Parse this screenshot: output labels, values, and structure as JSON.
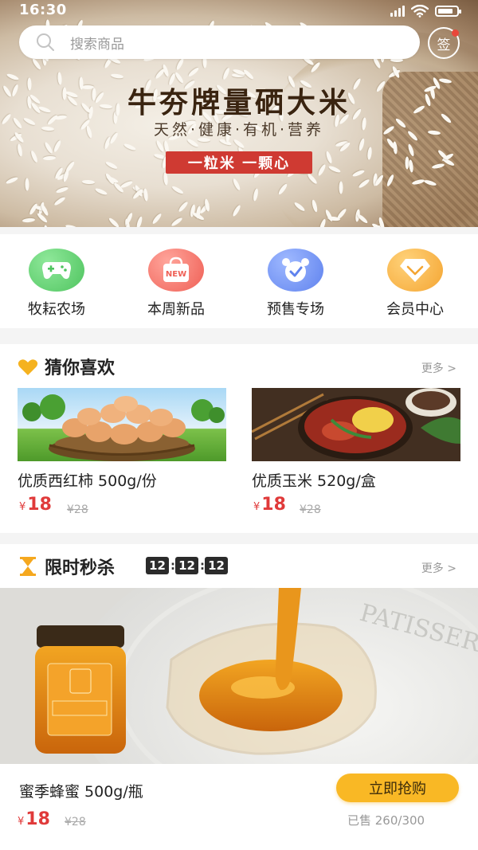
{
  "status_bar": {
    "time": "16:30"
  },
  "search": {
    "placeholder": "搜索商品"
  },
  "signin": {
    "label": "签"
  },
  "banner": {
    "title": "牛夯牌量硒大米",
    "subtitle": "天然·健康·有机·营养",
    "tagline": "一粒米 一颗心"
  },
  "categories": [
    {
      "label": "牧耘农场",
      "icon": "gamepad-icon",
      "color": "#5fcf6e"
    },
    {
      "label": "本周新品",
      "icon": "new-bag-icon",
      "color": "#f4736a",
      "badge": "NEW"
    },
    {
      "label": "预售专场",
      "icon": "alarm-clock-icon",
      "color": "#6b8ff5"
    },
    {
      "label": "会员中心",
      "icon": "diamond-icon",
      "color": "#f5b340"
    }
  ],
  "guess": {
    "title": "猜你喜欢",
    "more": "更多 >",
    "products": [
      {
        "name": "优质西红柿 500g/份",
        "currency": "¥",
        "price": "18",
        "old_price": "¥28",
        "image": "eggs-in-nest-photo"
      },
      {
        "name": "优质玉米 520g/盒",
        "currency": "¥",
        "price": "18",
        "old_price": "¥28",
        "image": "noodle-dish-photo"
      }
    ]
  },
  "flash": {
    "title": "限时秒杀",
    "more": "更多 >",
    "timer": {
      "h": "12",
      "m": "12",
      "s": "12"
    },
    "product": {
      "name": "蜜季蜂蜜 500g/瓶",
      "currency": "¥",
      "price": "18",
      "old_price": "¥28",
      "buy_label": "立即抢购",
      "sold": "已售 260/300",
      "image": "honey-jar-photo"
    }
  },
  "colors": {
    "accent": "#f9b825",
    "price": "#e03a3a",
    "tag": "#cf3a32"
  }
}
